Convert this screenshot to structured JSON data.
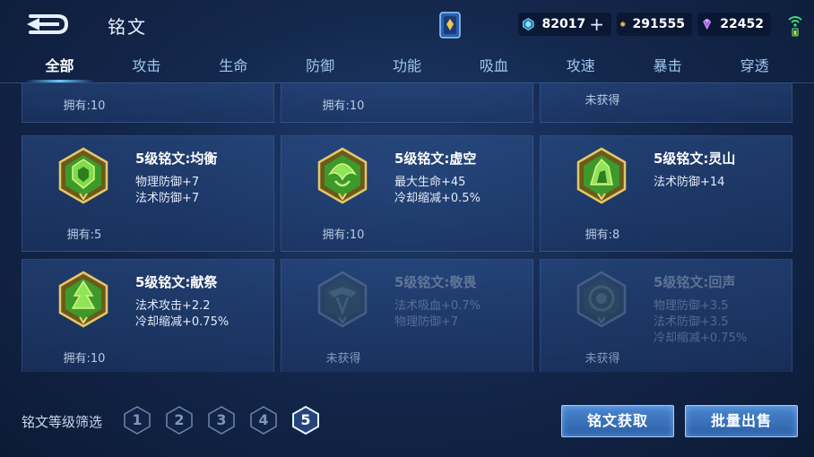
{
  "header": {
    "title": "铭文",
    "currencies": [
      {
        "icon": "diamond-coin-icon",
        "value": "82017",
        "color": "#6fd3ff"
      },
      {
        "icon": "gold-coin-icon",
        "value": "291555",
        "color": "#f0b94a"
      },
      {
        "icon": "gem-icon",
        "value": "22452",
        "color": "#c77dff"
      }
    ]
  },
  "tabs": [
    {
      "label": "全部",
      "active": true
    },
    {
      "label": "攻击",
      "active": false
    },
    {
      "label": "生命",
      "active": false
    },
    {
      "label": "防御",
      "active": false
    },
    {
      "label": "功能",
      "active": false
    },
    {
      "label": "吸血",
      "active": false
    },
    {
      "label": "攻速",
      "active": false
    },
    {
      "label": "暴击",
      "active": false
    },
    {
      "label": "穿透",
      "active": false
    }
  ],
  "partial_row": [
    {
      "owned": "拥有:10"
    },
    {
      "owned": "拥有:10"
    },
    {
      "owned": "未获得"
    }
  ],
  "cards": [
    {
      "name": "5级铭文:均衡",
      "stats": [
        "物理防御+7",
        "法术防御+7"
      ],
      "owned": "拥有:5",
      "locked": false,
      "icon": "inscription-balance-icon"
    },
    {
      "name": "5级铭文:虚空",
      "stats": [
        "最大生命+45",
        "冷却缩减+0.5%"
      ],
      "owned": "拥有:10",
      "locked": false,
      "icon": "inscription-void-icon"
    },
    {
      "name": "5级铭文:灵山",
      "stats": [
        "法术防御+14"
      ],
      "owned": "拥有:8",
      "locked": false,
      "icon": "inscription-mountain-icon"
    },
    {
      "name": "5级铭文:献祭",
      "stats": [
        "法术攻击+2.2",
        "冷却缩减+0.75%"
      ],
      "owned": "拥有:10",
      "locked": false,
      "icon": "inscription-sacrifice-icon"
    },
    {
      "name": "5级铭文:敬畏",
      "stats": [
        "法术吸血+0.7%",
        "物理防御+7"
      ],
      "owned": "未获得",
      "locked": true,
      "icon": "inscription-awe-icon"
    },
    {
      "name": "5级铭文:回声",
      "stats": [
        "物理防御+3.5",
        "法术防御+3.5",
        "冷却缩减+0.75%"
      ],
      "owned": "未获得",
      "locked": true,
      "icon": "inscription-echo-icon"
    }
  ],
  "filter": {
    "label": "铭文等级筛选",
    "levels": [
      "1",
      "2",
      "3",
      "4",
      "5"
    ],
    "selected": "5"
  },
  "buttons": {
    "get": "铭文获取",
    "sell": "批量出售"
  }
}
